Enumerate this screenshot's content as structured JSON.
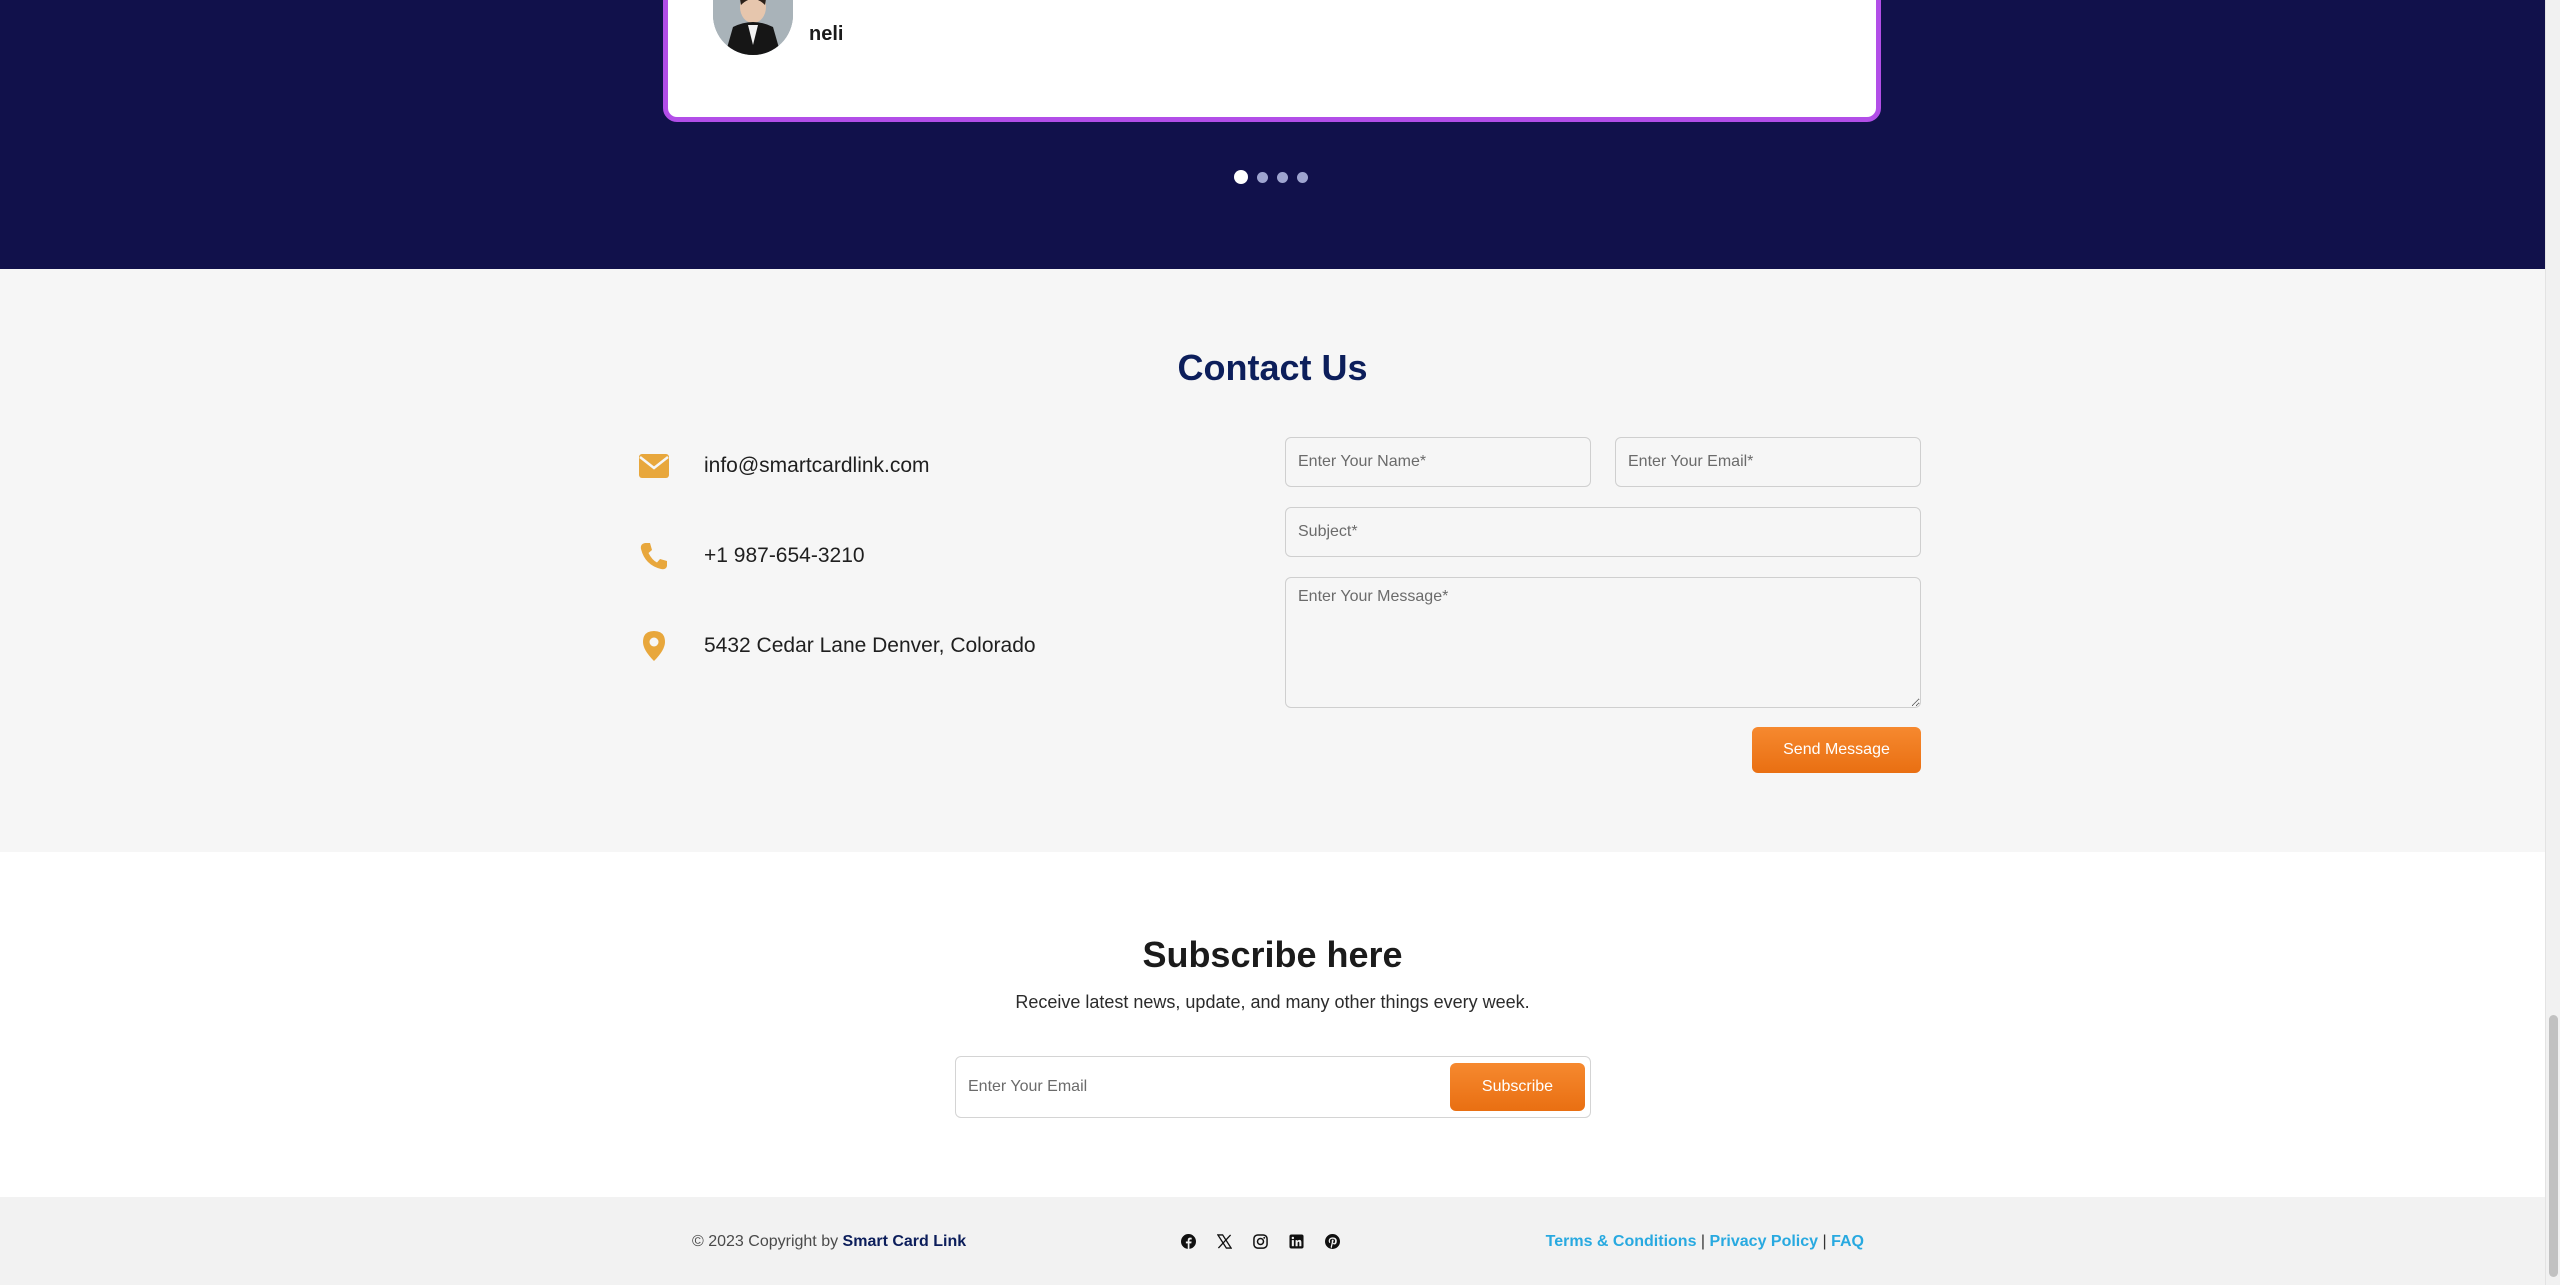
{
  "testimonial": {
    "name": "neli",
    "dots_count": 4,
    "active_dot": 0
  },
  "contact": {
    "title": "Contact Us",
    "email": "info@smartcardlink.com",
    "phone": "+1 987-654-3210",
    "address": "5432 Cedar Lane Denver, Colorado",
    "name_placeholder": "Enter Your Name*",
    "email_placeholder": "Enter Your Email*",
    "subject_placeholder": "Subject*",
    "message_placeholder": "Enter Your Message*",
    "send_label": "Send Message",
    "icon_color": "#e8a73c"
  },
  "subscribe": {
    "title": "Subscribe here",
    "description": "Receive latest news, update, and many other things every week.",
    "email_placeholder": "Enter Your Email",
    "button_label": "Subscribe"
  },
  "footer": {
    "copyright_prefix": "© 2023 Copyright by",
    "brand": "Smart Card Link",
    "socials": [
      "facebook-icon",
      "x-icon",
      "instagram-icon",
      "linkedin-icon",
      "pinterest-icon"
    ],
    "terms": "Terms & Conditions",
    "privacy": "Privacy Policy",
    "faq": "FAQ",
    "separator": "|"
  },
  "colors": {
    "band": "#11114b",
    "card_border": "#b24ee8",
    "accent_orange": "#f07d20",
    "title_navy": "#0c1e5b",
    "link_blue": "#28a9e0"
  }
}
